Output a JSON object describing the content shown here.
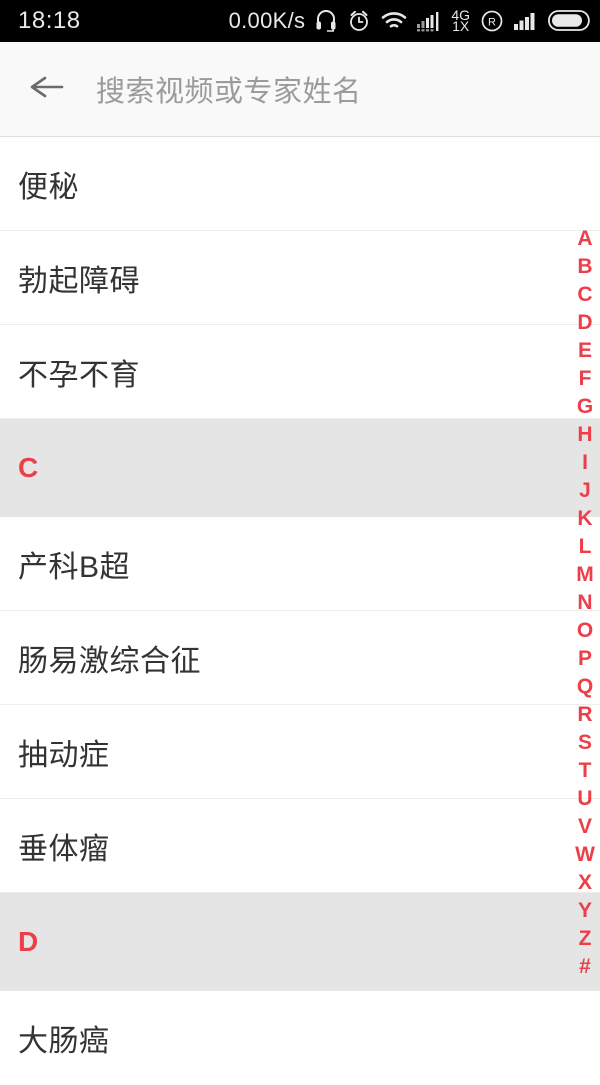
{
  "statusbar": {
    "time": "18:18",
    "network_speed": "0.00K/s",
    "network_type_primary": "4G",
    "network_type_secondary": "1X",
    "icons": [
      "headphone-icon",
      "alarm-clock-icon",
      "wifi-icon",
      "cellular-signal-icon",
      "roaming-icon",
      "signal-bars-icon",
      "battery-icon"
    ]
  },
  "toolbar": {
    "back_icon": "back-arrow-icon",
    "search_placeholder": "搜索视频或专家姓名"
  },
  "colors": {
    "accent_red": "#ec3f4a",
    "section_bg": "#e5e5e5",
    "row_bg": "#ffffff",
    "divider": "#ececec",
    "toolbar_bg": "#f9f9f9",
    "text_primary": "#333333",
    "placeholder": "#9b9b9b"
  },
  "list": [
    {
      "type": "item",
      "label": "便秘"
    },
    {
      "type": "item",
      "label": "勃起障碍"
    },
    {
      "type": "item",
      "label": "不孕不育"
    },
    {
      "type": "section",
      "label": "C"
    },
    {
      "type": "item",
      "label": "产科B超"
    },
    {
      "type": "item",
      "label": "肠易激综合征"
    },
    {
      "type": "item",
      "label": "抽动症"
    },
    {
      "type": "item",
      "label": "垂体瘤"
    },
    {
      "type": "section",
      "label": "D"
    },
    {
      "type": "item",
      "label": "大肠癌"
    }
  ],
  "index_bar": {
    "letters": [
      "A",
      "B",
      "C",
      "D",
      "E",
      "F",
      "G",
      "H",
      "I",
      "J",
      "K",
      "L",
      "M",
      "N",
      "O",
      "P",
      "Q",
      "R",
      "S",
      "T",
      "U",
      "V",
      "W",
      "X",
      "Y",
      "Z",
      "#"
    ]
  }
}
